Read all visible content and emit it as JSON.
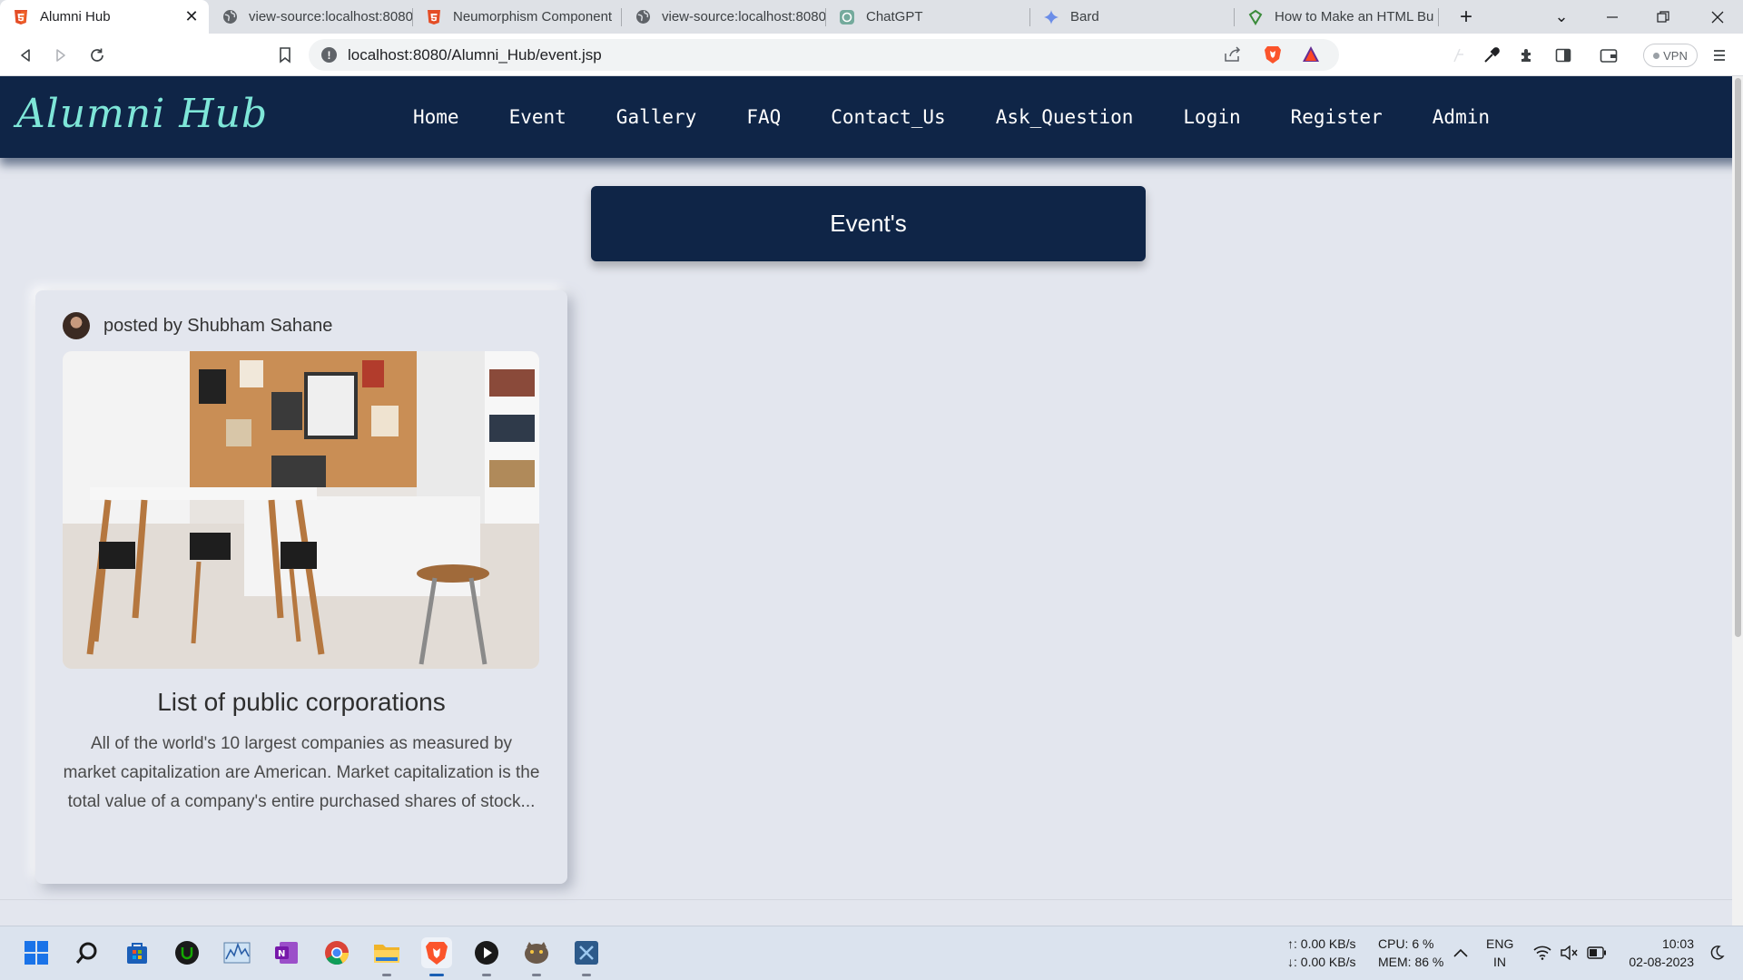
{
  "browser": {
    "tabs": [
      {
        "title": "Alumni Hub",
        "active": true
      },
      {
        "title": "view-source:localhost:8080"
      },
      {
        "title": "Neumorphism Component"
      },
      {
        "title": "view-source:localhost:8080"
      },
      {
        "title": "ChatGPT"
      },
      {
        "title": "Bard"
      },
      {
        "title": "How to Make an HTML Bu"
      }
    ],
    "url": "localhost:8080/Alumni_Hub/event.jsp",
    "vpn_label": "VPN"
  },
  "site": {
    "brand": "Alumni Hub",
    "nav": [
      "Home",
      "Event",
      "Gallery",
      "FAQ",
      "Contact_Us",
      "Ask_Question",
      "Login",
      "Register",
      "Admin"
    ],
    "banner": "Event's",
    "event": {
      "posted_by": "posted by Shubham Sahane",
      "title": "List of public corporations",
      "description": "All of the world's 10 largest companies as measured by market capitalization are American. Market capitalization is the total value of a company's entire purchased shares of stock..."
    }
  },
  "taskbar": {
    "net_up": "↑: 0.00 KB/s",
    "net_down": "↓: 0.00 KB/s",
    "cpu": "CPU: 6 %",
    "mem": "MEM: 86 %",
    "lang_1": "ENG",
    "lang_2": "IN",
    "time": "10:03",
    "date": "02-08-2023"
  },
  "colors": {
    "navbar": "#0f2547",
    "brand": "#7ee6d8",
    "page_bg": "#e3e6ee"
  }
}
